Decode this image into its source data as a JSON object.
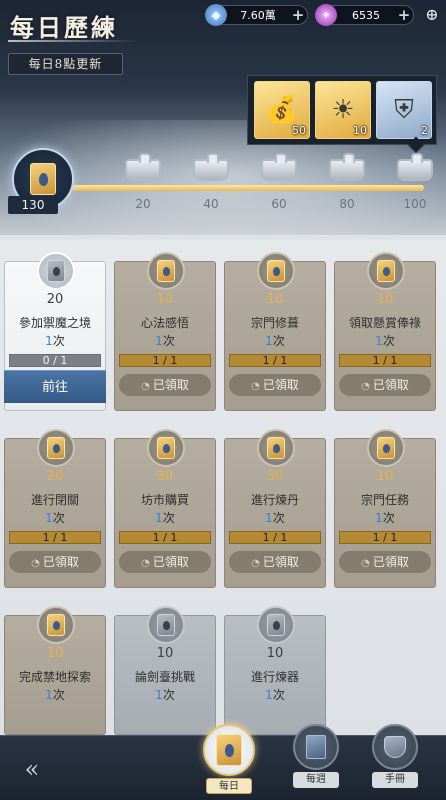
{
  "header": {
    "title": "每日歷練",
    "refresh_note": "每日8點更新"
  },
  "currencies": [
    {
      "icon": "crystal-icon",
      "value": "7.60萬",
      "plus": "+"
    },
    {
      "icon": "gem-icon",
      "value": "6535",
      "plus": "+"
    }
  ],
  "rewards": [
    {
      "icon": "gold-ingot-icon",
      "count": "50"
    },
    {
      "icon": "sun-orb-icon",
      "count": "10"
    },
    {
      "icon": "armor-chest-icon",
      "count": "2"
    }
  ],
  "progress": {
    "current": "130",
    "fraction_filled": 1.0,
    "milestones": [
      "20",
      "40",
      "60",
      "80",
      "100"
    ]
  },
  "tasks": [
    {
      "points": "20",
      "name": "參加禦魔之境",
      "count": "1",
      "count_unit": "次",
      "progress": "0 / 1",
      "button": "前往",
      "state": "active"
    },
    {
      "points": "10",
      "name": "心法感悟",
      "count": "1",
      "count_unit": "次",
      "progress": "1 / 1",
      "button": "已領取",
      "state": "claimed"
    },
    {
      "points": "10",
      "name": "宗門修葺",
      "count": "1",
      "count_unit": "次",
      "progress": "1 / 1",
      "button": "已領取",
      "state": "claimed"
    },
    {
      "points": "10",
      "name": "領取懸賞俸祿",
      "count": "1",
      "count_unit": "次",
      "progress": "1 / 1",
      "button": "已領取",
      "state": "claimed"
    },
    {
      "points": "20",
      "name": "進行閉關",
      "count": "1",
      "count_unit": "次",
      "progress": "1 / 1",
      "button": "已領取",
      "state": "claimed"
    },
    {
      "points": "30",
      "name": "坊市購買",
      "count": "1",
      "count_unit": "次",
      "progress": "1 / 1",
      "button": "已領取",
      "state": "claimed"
    },
    {
      "points": "30",
      "name": "進行煉丹",
      "count": "1",
      "count_unit": "次",
      "progress": "1 / 1",
      "button": "已領取",
      "state": "claimed"
    },
    {
      "points": "10",
      "name": "宗門任務",
      "count": "1",
      "count_unit": "次",
      "progress": "1 / 1",
      "button": "已領取",
      "state": "claimed"
    },
    {
      "points": "10",
      "name": "完成禁地探索",
      "count": "1",
      "count_unit": "次",
      "state": "claimed-incomplete"
    },
    {
      "points": "10",
      "name": "論劍臺挑戰",
      "count": "1",
      "count_unit": "次",
      "state": "locked"
    },
    {
      "points": "10",
      "name": "進行煉器",
      "count": "1",
      "count_unit": "次",
      "state": "locked"
    }
  ],
  "nav": {
    "back_icon": "back-arrow-icon",
    "tabs": [
      {
        "label": "每日",
        "icon": "daily-scroll-icon",
        "active": true
      },
      {
        "label": "每週",
        "icon": "weekly-book-icon",
        "active": false
      },
      {
        "label": "手冊",
        "icon": "manual-shield-icon",
        "active": false
      }
    ]
  }
}
